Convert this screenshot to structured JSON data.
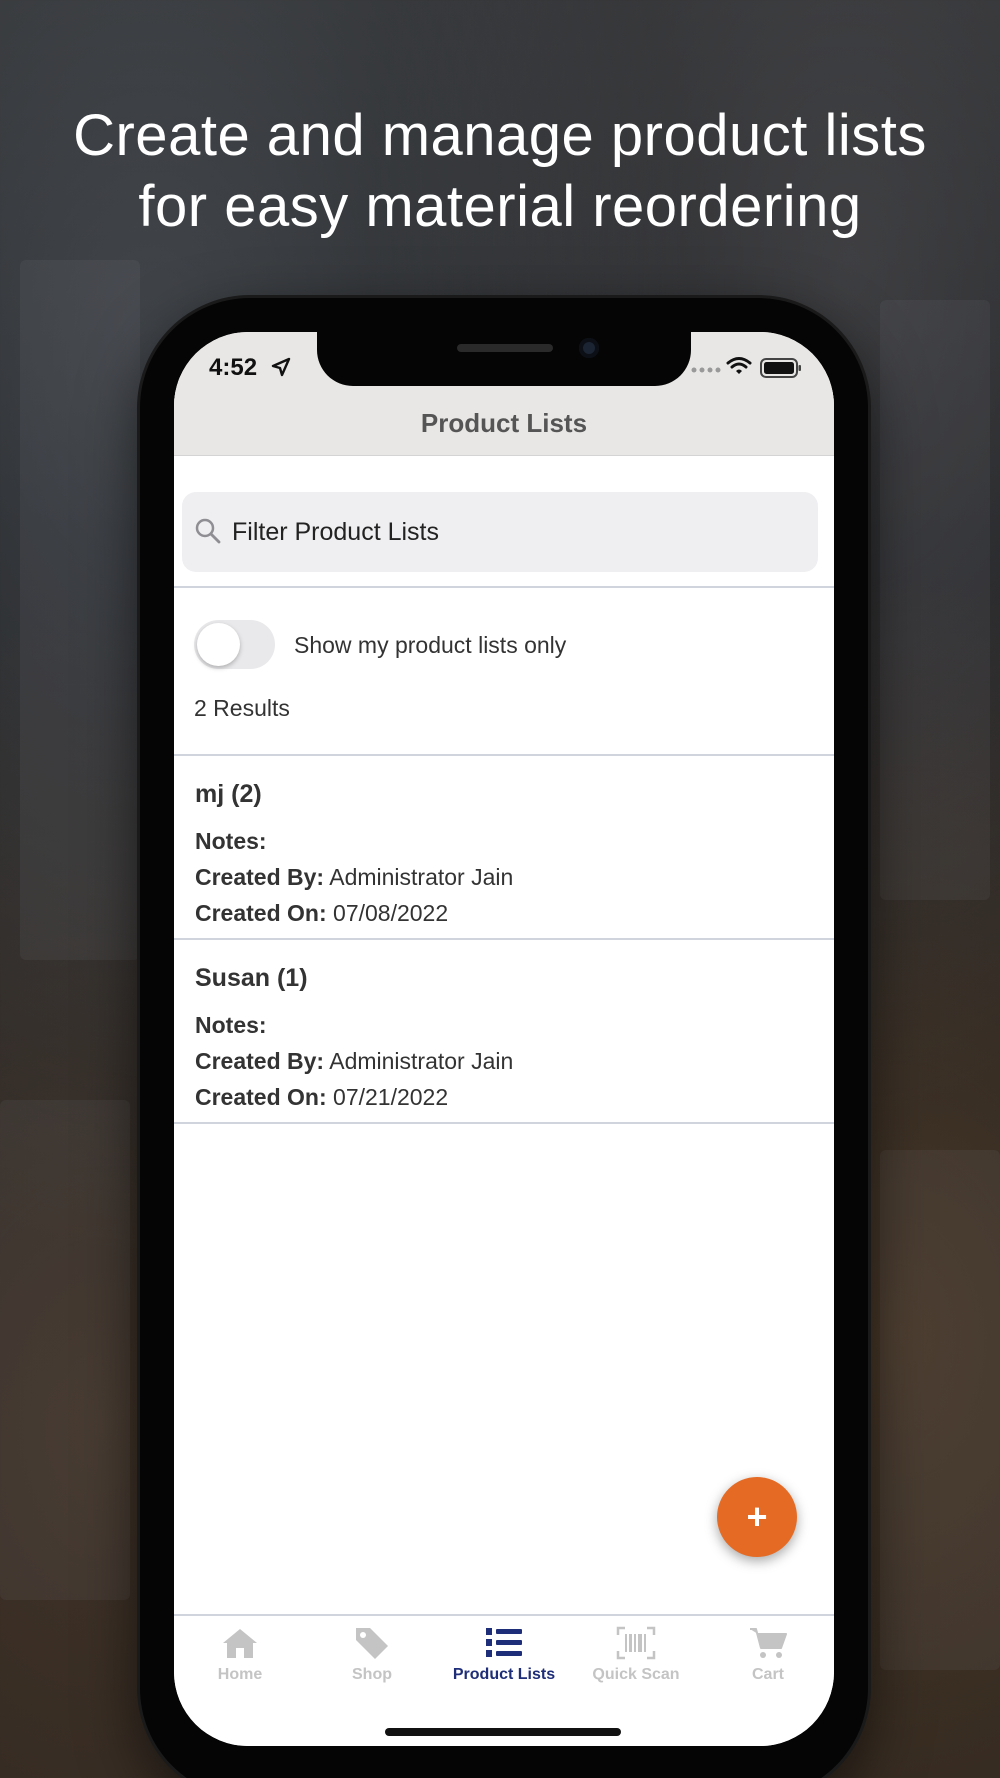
{
  "headline": {
    "line1": "Create and manage product lists",
    "line2": "for easy material reordering"
  },
  "status_bar": {
    "time": "4:52",
    "icons": [
      "location-arrow-icon",
      "signal-icon",
      "wifi-icon",
      "battery-icon"
    ]
  },
  "nav": {
    "title": "Product Lists"
  },
  "search": {
    "placeholder": "Filter Product Lists",
    "value": ""
  },
  "filter": {
    "toggle_label": "Show my product lists only",
    "toggle_on": false
  },
  "results_count": "2 Results",
  "labels": {
    "notes": "Notes:",
    "created_by": "Created By:",
    "created_on": "Created On:"
  },
  "lists": [
    {
      "title": "mj (2)",
      "notes": "",
      "created_by": "Administrator Jain",
      "created_on": "07/08/2022"
    },
    {
      "title": "Susan (1)",
      "notes": "",
      "created_by": "Administrator Jain",
      "created_on": "07/21/2022"
    }
  ],
  "fab": {
    "label": "+",
    "icon": "plus-icon"
  },
  "tabs": [
    {
      "label": "Home",
      "icon": "home-icon",
      "active": false
    },
    {
      "label": "Shop",
      "icon": "tag-icon",
      "active": false
    },
    {
      "label": "Product Lists",
      "icon": "numbered-list-icon",
      "active": true
    },
    {
      "label": "Quick Scan",
      "icon": "barcode-scan-icon",
      "active": false
    },
    {
      "label": "Cart",
      "icon": "cart-icon",
      "active": false
    }
  ],
  "colors": {
    "accent": "#e56a24",
    "active_tab": "#1f2e78",
    "inactive_tab": "#c4c4c4",
    "nav_background": "#e8e7e5"
  }
}
